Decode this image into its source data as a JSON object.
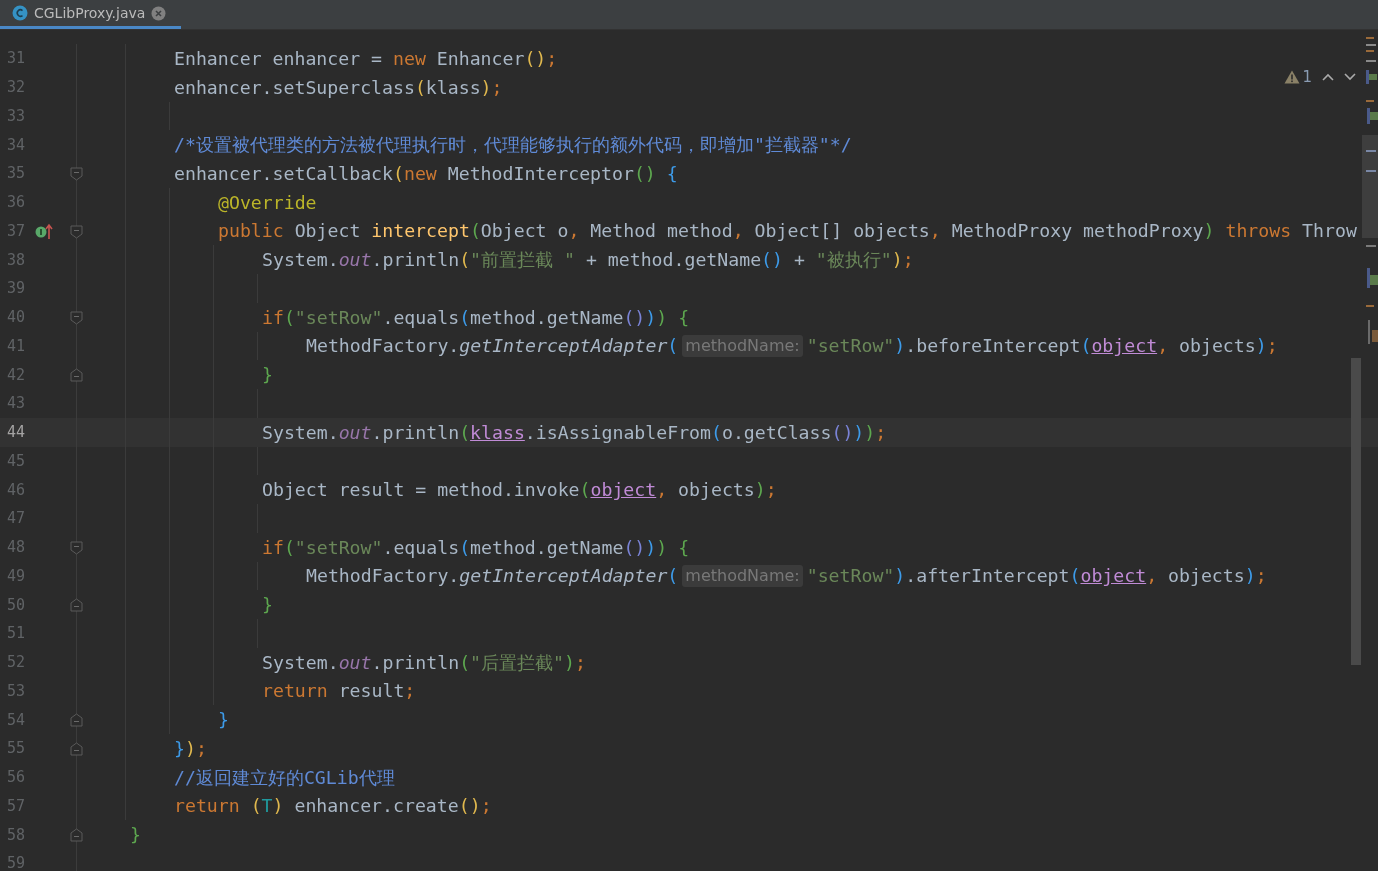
{
  "tab": {
    "title": "CGLibProxy.java",
    "selected": true
  },
  "inspections": {
    "warnings": "1"
  },
  "lines": [
    {
      "number": "31",
      "current": false,
      "fold_start": false,
      "fold_end": false,
      "implements_marker": false,
      "tokens": [
        {
          "text": "        Enhancer enhancer = ",
          "kind": "plain"
        },
        {
          "text": "new",
          "kind": "kw"
        },
        {
          "text": " Enhancer",
          "kind": "plain"
        },
        {
          "text": "()",
          "kind": "b1"
        },
        {
          "text": ";",
          "kind": "kw"
        }
      ]
    },
    {
      "number": "32",
      "current": false,
      "fold_start": false,
      "fold_end": false,
      "implements_marker": false,
      "tokens": [
        {
          "text": "        enhancer.setSuperclass",
          "kind": "plain"
        },
        {
          "text": "(",
          "kind": "b1"
        },
        {
          "text": "klass",
          "kind": "plain"
        },
        {
          "text": ")",
          "kind": "b1"
        },
        {
          "text": ";",
          "kind": "kw"
        }
      ]
    },
    {
      "number": "33",
      "current": false,
      "fold_start": false,
      "fold_end": false,
      "implements_marker": false
    },
    {
      "number": "34",
      "current": false,
      "fold_start": false,
      "fold_end": false,
      "implements_marker": false,
      "tokens": [
        {
          "text": "        /*设置被代理类的方法被代理执行时，代理能够执行的额外代码，即增加\"拦截器\"*/",
          "kind": "comment"
        }
      ]
    },
    {
      "number": "35",
      "current": false,
      "fold_start": true,
      "fold_end": false,
      "implements_marker": false,
      "tokens": [
        {
          "text": "        enhancer.setCallback",
          "kind": "plain"
        },
        {
          "text": "(",
          "kind": "b1"
        },
        {
          "text": "new",
          "kind": "kw"
        },
        {
          "text": " MethodInterceptor",
          "kind": "plain"
        },
        {
          "text": "() ",
          "kind": "b2"
        },
        {
          "text": "{",
          "kind": "b3"
        }
      ]
    },
    {
      "number": "36",
      "current": false,
      "fold_start": false,
      "fold_end": false,
      "implements_marker": false,
      "tokens": [
        {
          "text": "            @Override",
          "kind": "ann"
        }
      ]
    },
    {
      "number": "37",
      "current": false,
      "fold_start": true,
      "fold_end": false,
      "implements_marker": true,
      "tokens": [
        {
          "text": "            public",
          "kind": "kw"
        },
        {
          "text": " Object ",
          "kind": "plain"
        },
        {
          "text": "intercept",
          "kind": "decl"
        },
        {
          "text": "(",
          "kind": "b2"
        },
        {
          "text": "Object o",
          "kind": "plain"
        },
        {
          "text": ",",
          "kind": "kw"
        },
        {
          "text": " Method method",
          "kind": "plain"
        },
        {
          "text": ",",
          "kind": "kw"
        },
        {
          "text": " Object[] objects",
          "kind": "plain"
        },
        {
          "text": ",",
          "kind": "kw"
        },
        {
          "text": " MethodProxy methodProxy",
          "kind": "plain"
        },
        {
          "text": ") ",
          "kind": "b2"
        },
        {
          "text": "throws",
          "kind": "kw"
        },
        {
          "text": " Throw",
          "kind": "plain"
        }
      ]
    },
    {
      "number": "38",
      "current": false,
      "fold_start": false,
      "fold_end": false,
      "implements_marker": false,
      "tokens": [
        {
          "text": "                System.",
          "kind": "plain"
        },
        {
          "text": "out",
          "kind": "field"
        },
        {
          "text": ".println",
          "kind": "plain"
        },
        {
          "text": "(",
          "kind": "b1"
        },
        {
          "text": "\"前置拦截 \"",
          "kind": "str"
        },
        {
          "text": " + method.getName",
          "kind": "plain"
        },
        {
          "text": "()",
          "kind": "b3"
        },
        {
          "text": " + ",
          "kind": "plain"
        },
        {
          "text": "\"被执行\"",
          "kind": "str"
        },
        {
          "text": ")",
          "kind": "b1"
        },
        {
          "text": ";",
          "kind": "kw"
        }
      ]
    },
    {
      "number": "39",
      "current": false,
      "fold_start": false,
      "fold_end": false,
      "implements_marker": false
    },
    {
      "number": "40",
      "current": false,
      "fold_start": true,
      "fold_end": false,
      "implements_marker": false,
      "tokens": [
        {
          "text": "                if",
          "kind": "kw"
        },
        {
          "text": "(",
          "kind": "b2"
        },
        {
          "text": "\"setRow\"",
          "kind": "str"
        },
        {
          "text": ".equals",
          "kind": "plain"
        },
        {
          "text": "(",
          "kind": "b3"
        },
        {
          "text": "method.getName",
          "kind": "plain"
        },
        {
          "text": "()",
          "kind": "b4"
        },
        {
          "text": ")",
          "kind": "b3"
        },
        {
          "text": ") ",
          "kind": "b2"
        },
        {
          "text": "{",
          "kind": "b2"
        }
      ]
    },
    {
      "number": "41",
      "current": false,
      "fold_start": false,
      "fold_end": false,
      "implements_marker": false,
      "tokens": [
        {
          "text": "                    MethodFactory.",
          "kind": "plain"
        },
        {
          "text": "getInterceptAdapter",
          "kind": "italic"
        },
        {
          "text": "(",
          "kind": "b3"
        },
        {
          "text": "methodName:",
          "kind": "hint"
        },
        {
          "text": "\"setRow\"",
          "kind": "str"
        },
        {
          "text": ")",
          "kind": "b3"
        },
        {
          "text": ".beforeIntercept",
          "kind": "plain"
        },
        {
          "text": "(",
          "kind": "b3"
        },
        {
          "text": "object",
          "kind": "ref"
        },
        {
          "text": ",",
          "kind": "kw"
        },
        {
          "text": " objects",
          "kind": "plain"
        },
        {
          "text": ")",
          "kind": "b3"
        },
        {
          "text": ";",
          "kind": "kw"
        }
      ]
    },
    {
      "number": "42",
      "current": false,
      "fold_start": false,
      "fold_end": true,
      "implements_marker": false,
      "tokens": [
        {
          "text": "                }",
          "kind": "b2"
        }
      ]
    },
    {
      "number": "43",
      "current": false,
      "fold_start": false,
      "fold_end": false,
      "implements_marker": false
    },
    {
      "number": "44",
      "current": true,
      "fold_start": false,
      "fold_end": false,
      "implements_marker": false,
      "tokens": [
        {
          "text": "                System.",
          "kind": "plain"
        },
        {
          "text": "out",
          "kind": "field"
        },
        {
          "text": ".println",
          "kind": "plain"
        },
        {
          "text": "(",
          "kind": "b2"
        },
        {
          "text": "klass",
          "kind": "ref"
        },
        {
          "text": ".isAssignableFrom",
          "kind": "plain"
        },
        {
          "text": "(",
          "kind": "b3"
        },
        {
          "text": "o.getClass",
          "kind": "plain"
        },
        {
          "text": "()",
          "kind": "b4"
        },
        {
          "text": ")",
          "kind": "b3"
        },
        {
          "text": ")",
          "kind": "b2"
        },
        {
          "text": ";",
          "kind": "kw"
        }
      ]
    },
    {
      "number": "45",
      "current": false,
      "fold_start": false,
      "fold_end": false,
      "implements_marker": false
    },
    {
      "number": "46",
      "current": false,
      "fold_start": false,
      "fold_end": false,
      "implements_marker": false,
      "tokens": [
        {
          "text": "                Object result = method.invoke",
          "kind": "plain"
        },
        {
          "text": "(",
          "kind": "b2"
        },
        {
          "text": "object",
          "kind": "ref"
        },
        {
          "text": ",",
          "kind": "kw"
        },
        {
          "text": " objects",
          "kind": "plain"
        },
        {
          "text": ")",
          "kind": "b2"
        },
        {
          "text": ";",
          "kind": "kw"
        }
      ]
    },
    {
      "number": "47",
      "current": false,
      "fold_start": false,
      "fold_end": false,
      "implements_marker": false
    },
    {
      "number": "48",
      "current": false,
      "fold_start": true,
      "fold_end": false,
      "implements_marker": false,
      "tokens": [
        {
          "text": "                if",
          "kind": "kw"
        },
        {
          "text": "(",
          "kind": "b2"
        },
        {
          "text": "\"setRow\"",
          "kind": "str"
        },
        {
          "text": ".equals",
          "kind": "plain"
        },
        {
          "text": "(",
          "kind": "b3"
        },
        {
          "text": "method.getName",
          "kind": "plain"
        },
        {
          "text": "()",
          "kind": "b4"
        },
        {
          "text": ")",
          "kind": "b3"
        },
        {
          "text": ") ",
          "kind": "b2"
        },
        {
          "text": "{",
          "kind": "b2"
        }
      ]
    },
    {
      "number": "49",
      "current": false,
      "fold_start": false,
      "fold_end": false,
      "implements_marker": false,
      "tokens": [
        {
          "text": "                    MethodFactory.",
          "kind": "plain"
        },
        {
          "text": "getInterceptAdapter",
          "kind": "italic"
        },
        {
          "text": "(",
          "kind": "b3"
        },
        {
          "text": "methodName:",
          "kind": "hint"
        },
        {
          "text": "\"setRow\"",
          "kind": "str"
        },
        {
          "text": ")",
          "kind": "b3"
        },
        {
          "text": ".afterIntercept",
          "kind": "plain"
        },
        {
          "text": "(",
          "kind": "b3"
        },
        {
          "text": "object",
          "kind": "ref"
        },
        {
          "text": ",",
          "kind": "kw"
        },
        {
          "text": " objects",
          "kind": "plain"
        },
        {
          "text": ")",
          "kind": "b3"
        },
        {
          "text": ";",
          "kind": "kw"
        }
      ]
    },
    {
      "number": "50",
      "current": false,
      "fold_start": false,
      "fold_end": true,
      "implements_marker": false,
      "tokens": [
        {
          "text": "                }",
          "kind": "b2"
        }
      ]
    },
    {
      "number": "51",
      "current": false,
      "fold_start": false,
      "fold_end": false,
      "implements_marker": false
    },
    {
      "number": "52",
      "current": false,
      "fold_start": false,
      "fold_end": false,
      "implements_marker": false,
      "tokens": [
        {
          "text": "                System.",
          "kind": "plain"
        },
        {
          "text": "out",
          "kind": "field"
        },
        {
          "text": ".println",
          "kind": "plain"
        },
        {
          "text": "(",
          "kind": "b2"
        },
        {
          "text": "\"后置拦截\"",
          "kind": "str"
        },
        {
          "text": ")",
          "kind": "b2"
        },
        {
          "text": ";",
          "kind": "kw"
        }
      ]
    },
    {
      "number": "53",
      "current": false,
      "fold_start": false,
      "fold_end": false,
      "implements_marker": false,
      "tokens": [
        {
          "text": "                return",
          "kind": "kw"
        },
        {
          "text": " result",
          "kind": "plain"
        },
        {
          "text": ";",
          "kind": "kw"
        }
      ]
    },
    {
      "number": "54",
      "current": false,
      "fold_start": false,
      "fold_end": true,
      "implements_marker": false,
      "tokens": [
        {
          "text": "            }",
          "kind": "b3"
        }
      ]
    },
    {
      "number": "55",
      "current": false,
      "fold_start": false,
      "fold_end": true,
      "implements_marker": false,
      "tokens": [
        {
          "text": "        }",
          "kind": "b3"
        },
        {
          "text": ")",
          "kind": "b1"
        },
        {
          "text": ";",
          "kind": "kw"
        }
      ]
    },
    {
      "number": "56",
      "current": false,
      "fold_start": false,
      "fold_end": false,
      "implements_marker": false,
      "tokens": [
        {
          "text": "        //返回建立好的CGLib代理",
          "kind": "comment"
        }
      ]
    },
    {
      "number": "57",
      "current": false,
      "fold_start": false,
      "fold_end": false,
      "implements_marker": false,
      "tokens": [
        {
          "text": "        return ",
          "kind": "kw"
        },
        {
          "text": "(",
          "kind": "b1"
        },
        {
          "text": "T",
          "kind": "type"
        },
        {
          "text": ")",
          "kind": "b1"
        },
        {
          "text": " enhancer.create",
          "kind": "plain"
        },
        {
          "text": "()",
          "kind": "b1"
        },
        {
          "text": ";",
          "kind": "kw"
        }
      ]
    },
    {
      "number": "58",
      "current": false,
      "fold_start": false,
      "fold_end": true,
      "implements_marker": false,
      "tokens": [
        {
          "text": "    }",
          "kind": "b2"
        }
      ]
    },
    {
      "number": "59",
      "current": false,
      "fold_start": false,
      "fold_end": false,
      "implements_marker": false
    }
  ]
}
